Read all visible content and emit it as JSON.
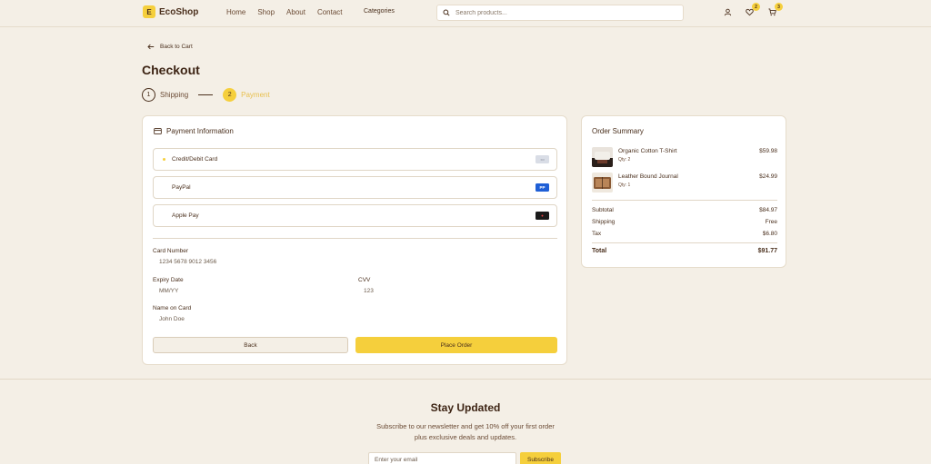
{
  "header": {
    "logo_letter": "E",
    "brand": "EcoShop",
    "nav": [
      "Home",
      "Shop",
      "About",
      "Contact"
    ],
    "categories_label": "Categories",
    "search_placeholder": "Search products...",
    "wishlist_count": "2",
    "cart_count": "3",
    "icons": [
      "user-icon",
      "heart-icon",
      "cart-icon",
      "search-icon"
    ]
  },
  "page": {
    "back_label": "Back to Cart",
    "title": "Checkout",
    "steps": [
      {
        "num": "1",
        "label": "Shipping",
        "state": "done"
      },
      {
        "num": "2",
        "label": "Payment",
        "state": "active"
      }
    ]
  },
  "payment": {
    "title": "Payment Information",
    "methods": [
      {
        "label": "Credit/Debit Card",
        "tag": "▭",
        "tag_color": "#d9dde6",
        "selected": true
      },
      {
        "label": "PayPal",
        "tag": "PP",
        "tag_color": "#1f5fd6",
        "selected": false
      },
      {
        "label": "Apple Pay",
        "tag": "●",
        "tag_color": "#1a1a1a",
        "selected": false
      }
    ],
    "card_number_label": "Card Number",
    "card_number_placeholder": "1234 5678 9012 3456",
    "expiry_label": "Expiry Date",
    "expiry_placeholder": "MM/YY",
    "cvv_label": "CVV",
    "cvv_placeholder": "123",
    "name_label": "Name on Card",
    "name_placeholder": "John Doe",
    "back_button": "Back",
    "place_button": "Place Order"
  },
  "summary": {
    "title": "Order Summary",
    "items": [
      {
        "name": "Organic Cotton T-Shirt",
        "qty": "Qty: 2",
        "price": "$59.98"
      },
      {
        "name": "Leather Bound Journal",
        "qty": "Qty: 1",
        "price": "$24.99"
      }
    ],
    "subtotal_label": "Subtotal",
    "subtotal": "$84.97",
    "shipping_label": "Shipping",
    "shipping": "Free",
    "tax_label": "Tax",
    "tax": "$6.80",
    "total_label": "Total",
    "total": "$91.77"
  },
  "footer": {
    "title": "Stay Updated",
    "subtitle_line1": "Subscribe to our newsletter and get 10% off your first order",
    "subtitle_line2": "plus exclusive deals and updates.",
    "email_placeholder": "Enter your email",
    "subscribe": "Subscribe"
  },
  "colors": {
    "accent": "#f5cf3c",
    "background": "#f4efe6",
    "text": "#4a2f1c"
  }
}
